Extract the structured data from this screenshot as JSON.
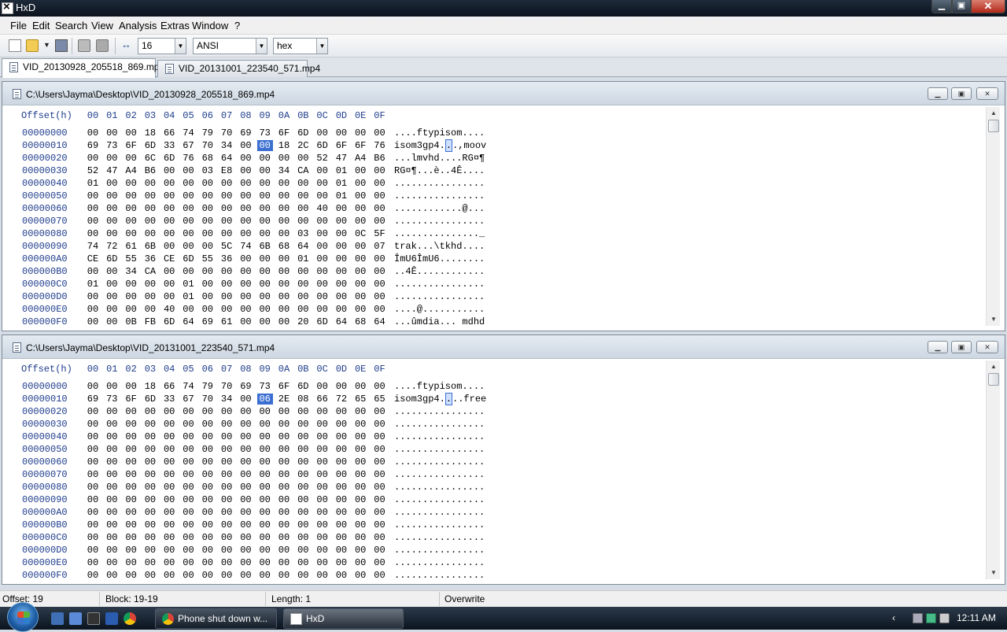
{
  "window": {
    "title": "HxD",
    "min_symbol": "▁",
    "max_symbol": "▣",
    "close_symbol": "✕"
  },
  "menu": {
    "file": "File",
    "edit": "Edit",
    "search": "Search",
    "view": "View",
    "analysis": "Analysis",
    "extras": "Extras",
    "window": "Window",
    "help": "?"
  },
  "toolbar": {
    "bytes_per_row": "16",
    "charset": "ANSI",
    "offset_base": "hex",
    "dropdown_symbol": "▼"
  },
  "tabs": [
    "VID_20130928_205518_869.mp4",
    "VID_20131001_223540_571.mp4"
  ],
  "hex_header": {
    "offset_label": "Offset(h)",
    "columns": [
      "00",
      "01",
      "02",
      "03",
      "04",
      "05",
      "06",
      "07",
      "08",
      "09",
      "0A",
      "0B",
      "0C",
      "0D",
      "0E",
      "0F"
    ]
  },
  "editors": [
    {
      "path": "C:\\Users\\Jayma\\Desktop\\VID_20130928_205518_869.mp4",
      "selected": {
        "row": 1,
        "col": 9
      },
      "rows": [
        {
          "offset": "00000000",
          "bytes": [
            "00",
            "00",
            "00",
            "18",
            "66",
            "74",
            "79",
            "70",
            "69",
            "73",
            "6F",
            "6D",
            "00",
            "00",
            "00",
            "00"
          ],
          "ascii": "....ftypisom...."
        },
        {
          "offset": "00000010",
          "bytes": [
            "69",
            "73",
            "6F",
            "6D",
            "33",
            "67",
            "70",
            "34",
            "00",
            "00",
            "18",
            "2C",
            "6D",
            "6F",
            "6F",
            "76"
          ],
          "ascii": "isom3gp4...,moov"
        },
        {
          "offset": "00000020",
          "bytes": [
            "00",
            "00",
            "00",
            "6C",
            "6D",
            "76",
            "68",
            "64",
            "00",
            "00",
            "00",
            "00",
            "52",
            "47",
            "A4",
            "B6"
          ],
          "ascii": "...lmvhd....RG¤¶"
        },
        {
          "offset": "00000030",
          "bytes": [
            "52",
            "47",
            "A4",
            "B6",
            "00",
            "00",
            "03",
            "E8",
            "00",
            "00",
            "34",
            "CA",
            "00",
            "01",
            "00",
            "00"
          ],
          "ascii": "RG¤¶...è..4Ê...."
        },
        {
          "offset": "00000040",
          "bytes": [
            "01",
            "00",
            "00",
            "00",
            "00",
            "00",
            "00",
            "00",
            "00",
            "00",
            "00",
            "00",
            "00",
            "01",
            "00",
            "00"
          ],
          "ascii": "................"
        },
        {
          "offset": "00000050",
          "bytes": [
            "00",
            "00",
            "00",
            "00",
            "00",
            "00",
            "00",
            "00",
            "00",
            "00",
            "00",
            "00",
            "00",
            "01",
            "00",
            "00"
          ],
          "ascii": "................"
        },
        {
          "offset": "00000060",
          "bytes": [
            "00",
            "00",
            "00",
            "00",
            "00",
            "00",
            "00",
            "00",
            "00",
            "00",
            "00",
            "00",
            "40",
            "00",
            "00",
            "00"
          ],
          "ascii": "............@..."
        },
        {
          "offset": "00000070",
          "bytes": [
            "00",
            "00",
            "00",
            "00",
            "00",
            "00",
            "00",
            "00",
            "00",
            "00",
            "00",
            "00",
            "00",
            "00",
            "00",
            "00"
          ],
          "ascii": "................"
        },
        {
          "offset": "00000080",
          "bytes": [
            "00",
            "00",
            "00",
            "00",
            "00",
            "00",
            "00",
            "00",
            "00",
            "00",
            "00",
            "03",
            "00",
            "00",
            "0C",
            "5F"
          ],
          "ascii": "..............._"
        },
        {
          "offset": "00000090",
          "bytes": [
            "74",
            "72",
            "61",
            "6B",
            "00",
            "00",
            "00",
            "5C",
            "74",
            "6B",
            "68",
            "64",
            "00",
            "00",
            "00",
            "07"
          ],
          "ascii": "trak...\\tkhd...."
        },
        {
          "offset": "000000A0",
          "bytes": [
            "CE",
            "6D",
            "55",
            "36",
            "CE",
            "6D",
            "55",
            "36",
            "00",
            "00",
            "00",
            "01",
            "00",
            "00",
            "00",
            "00"
          ],
          "ascii": "ÎmU6ÎmU6........"
        },
        {
          "offset": "000000B0",
          "bytes": [
            "00",
            "00",
            "34",
            "CA",
            "00",
            "00",
            "00",
            "00",
            "00",
            "00",
            "00",
            "00",
            "00",
            "00",
            "00",
            "00"
          ],
          "ascii": "..4Ê............"
        },
        {
          "offset": "000000C0",
          "bytes": [
            "01",
            "00",
            "00",
            "00",
            "00",
            "01",
            "00",
            "00",
            "00",
            "00",
            "00",
            "00",
            "00",
            "00",
            "00",
            "00"
          ],
          "ascii": "................"
        },
        {
          "offset": "000000D0",
          "bytes": [
            "00",
            "00",
            "00",
            "00",
            "00",
            "01",
            "00",
            "00",
            "00",
            "00",
            "00",
            "00",
            "00",
            "00",
            "00",
            "00"
          ],
          "ascii": "................"
        },
        {
          "offset": "000000E0",
          "bytes": [
            "00",
            "00",
            "00",
            "00",
            "40",
            "00",
            "00",
            "00",
            "00",
            "00",
            "00",
            "00",
            "00",
            "00",
            "00",
            "00"
          ],
          "ascii": "....@..........."
        },
        {
          "offset": "000000F0",
          "bytes": [
            "00",
            "00",
            "0B",
            "FB",
            "6D",
            "64",
            "69",
            "61",
            "00",
            "00",
            "00",
            "20",
            "6D",
            "64",
            "68",
            "64"
          ],
          "ascii": "...ûmdia... mdhd"
        }
      ]
    },
    {
      "path": "C:\\Users\\Jayma\\Desktop\\VID_20131001_223540_571.mp4",
      "selected": {
        "row": 1,
        "col": 9
      },
      "rows": [
        {
          "offset": "00000000",
          "bytes": [
            "00",
            "00",
            "00",
            "18",
            "66",
            "74",
            "79",
            "70",
            "69",
            "73",
            "6F",
            "6D",
            "00",
            "00",
            "00",
            "00"
          ],
          "ascii": "....ftypisom...."
        },
        {
          "offset": "00000010",
          "bytes": [
            "69",
            "73",
            "6F",
            "6D",
            "33",
            "67",
            "70",
            "34",
            "00",
            "06",
            "2E",
            "08",
            "66",
            "72",
            "65",
            "65"
          ],
          "ascii": "isom3gp4....free"
        },
        {
          "offset": "00000020",
          "bytes": [
            "00",
            "00",
            "00",
            "00",
            "00",
            "00",
            "00",
            "00",
            "00",
            "00",
            "00",
            "00",
            "00",
            "00",
            "00",
            "00"
          ],
          "ascii": "................"
        },
        {
          "offset": "00000030",
          "bytes": [
            "00",
            "00",
            "00",
            "00",
            "00",
            "00",
            "00",
            "00",
            "00",
            "00",
            "00",
            "00",
            "00",
            "00",
            "00",
            "00"
          ],
          "ascii": "................"
        },
        {
          "offset": "00000040",
          "bytes": [
            "00",
            "00",
            "00",
            "00",
            "00",
            "00",
            "00",
            "00",
            "00",
            "00",
            "00",
            "00",
            "00",
            "00",
            "00",
            "00"
          ],
          "ascii": "................"
        },
        {
          "offset": "00000050",
          "bytes": [
            "00",
            "00",
            "00",
            "00",
            "00",
            "00",
            "00",
            "00",
            "00",
            "00",
            "00",
            "00",
            "00",
            "00",
            "00",
            "00"
          ],
          "ascii": "................"
        },
        {
          "offset": "00000060",
          "bytes": [
            "00",
            "00",
            "00",
            "00",
            "00",
            "00",
            "00",
            "00",
            "00",
            "00",
            "00",
            "00",
            "00",
            "00",
            "00",
            "00"
          ],
          "ascii": "................"
        },
        {
          "offset": "00000070",
          "bytes": [
            "00",
            "00",
            "00",
            "00",
            "00",
            "00",
            "00",
            "00",
            "00",
            "00",
            "00",
            "00",
            "00",
            "00",
            "00",
            "00"
          ],
          "ascii": "................"
        },
        {
          "offset": "00000080",
          "bytes": [
            "00",
            "00",
            "00",
            "00",
            "00",
            "00",
            "00",
            "00",
            "00",
            "00",
            "00",
            "00",
            "00",
            "00",
            "00",
            "00"
          ],
          "ascii": "................"
        },
        {
          "offset": "00000090",
          "bytes": [
            "00",
            "00",
            "00",
            "00",
            "00",
            "00",
            "00",
            "00",
            "00",
            "00",
            "00",
            "00",
            "00",
            "00",
            "00",
            "00"
          ],
          "ascii": "................"
        },
        {
          "offset": "000000A0",
          "bytes": [
            "00",
            "00",
            "00",
            "00",
            "00",
            "00",
            "00",
            "00",
            "00",
            "00",
            "00",
            "00",
            "00",
            "00",
            "00",
            "00"
          ],
          "ascii": "................"
        },
        {
          "offset": "000000B0",
          "bytes": [
            "00",
            "00",
            "00",
            "00",
            "00",
            "00",
            "00",
            "00",
            "00",
            "00",
            "00",
            "00",
            "00",
            "00",
            "00",
            "00"
          ],
          "ascii": "................"
        },
        {
          "offset": "000000C0",
          "bytes": [
            "00",
            "00",
            "00",
            "00",
            "00",
            "00",
            "00",
            "00",
            "00",
            "00",
            "00",
            "00",
            "00",
            "00",
            "00",
            "00"
          ],
          "ascii": "................"
        },
        {
          "offset": "000000D0",
          "bytes": [
            "00",
            "00",
            "00",
            "00",
            "00",
            "00",
            "00",
            "00",
            "00",
            "00",
            "00",
            "00",
            "00",
            "00",
            "00",
            "00"
          ],
          "ascii": "................"
        },
        {
          "offset": "000000E0",
          "bytes": [
            "00",
            "00",
            "00",
            "00",
            "00",
            "00",
            "00",
            "00",
            "00",
            "00",
            "00",
            "00",
            "00",
            "00",
            "00",
            "00"
          ],
          "ascii": "................"
        },
        {
          "offset": "000000F0",
          "bytes": [
            "00",
            "00",
            "00",
            "00",
            "00",
            "00",
            "00",
            "00",
            "00",
            "00",
            "00",
            "00",
            "00",
            "00",
            "00",
            "00"
          ],
          "ascii": "................"
        }
      ]
    }
  ],
  "status": {
    "offset": "Offset: 19",
    "block": "Block: 19-19",
    "length": "Length: 1",
    "mode": "Overwrite"
  },
  "taskbar": {
    "chrome_task": "Phone shut down w...",
    "hxd_task": "HxD",
    "tray_chevron": "‹",
    "clock": "12:11 AM"
  },
  "colors": {
    "selection": "#3b6fd2",
    "offset_text": "#1e3c8c"
  },
  "icons": [
    "app-icon",
    "new-file-icon",
    "open-folder-icon",
    "save-icon",
    "print-icon",
    "columns-icon",
    "file-hex-icon",
    "windows-start-icon",
    "chrome-icon",
    "scroll-up-icon",
    "scroll-down-icon"
  ]
}
